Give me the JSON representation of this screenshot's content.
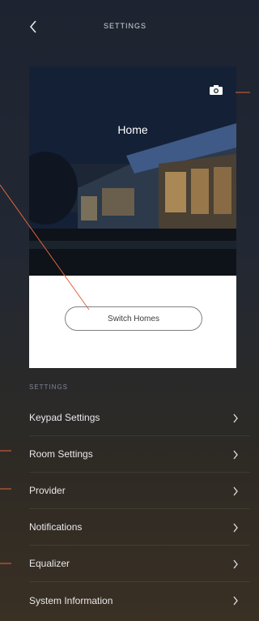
{
  "header": {
    "title": "SETTINGS",
    "back_icon": "chevron-left-icon"
  },
  "home_card": {
    "name": "Home",
    "camera_icon": "camera-icon",
    "switch_button_label": "Switch Homes"
  },
  "settings": {
    "section_label": "SETTINGS",
    "items": [
      {
        "label": "Keypad Settings"
      },
      {
        "label": "Room Settings"
      },
      {
        "label": "Provider"
      },
      {
        "label": "Notifications"
      },
      {
        "label": "Equalizer"
      },
      {
        "label": "System Information"
      }
    ],
    "chevron_icon": "chevron-right-icon"
  },
  "colors": {
    "annotation_line": "#e2643c",
    "card_bottom": "#ffffff"
  }
}
